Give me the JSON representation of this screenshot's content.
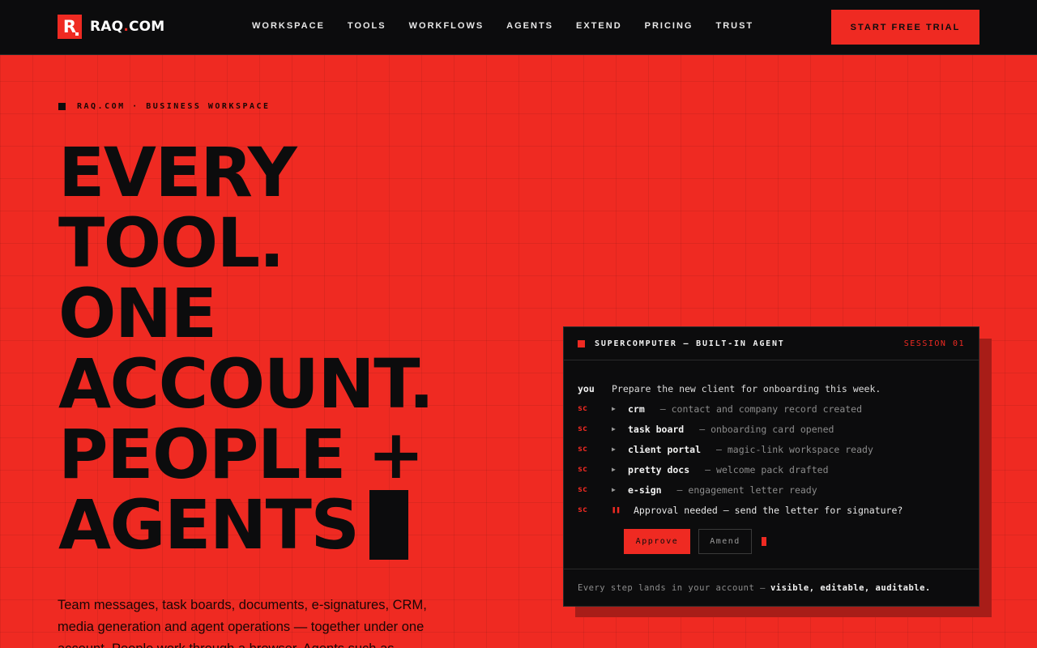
{
  "nav": {
    "logo_mark": "R",
    "logo_name": "RAQ",
    "logo_dot": ".",
    "logo_tld": "COM",
    "links": [
      "WORKSPACE",
      "TOOLS",
      "WORKFLOWS",
      "AGENTS",
      "EXTEND",
      "PRICING",
      "TRUST"
    ],
    "cta_label": "START FREE TRIAL"
  },
  "hero": {
    "eyebrow": "RAQ.COM · BUSINESS WORKSPACE",
    "headline_lines": [
      "EVERY",
      "TOOL.",
      "ONE",
      "ACCOUNT.",
      "PEOPLE +",
      "AGENTS"
    ],
    "subcopy": "Team messages, task boards, documents, e-signatures, CRM, media generation and agent operations — together under one account. People work through a browser. Agents such as"
  },
  "panel": {
    "title": "SUPERCOMPUTER — BUILT-IN AGENT",
    "session": "SESSION 01",
    "user_label": "you",
    "user_message": "Prepare the new client for onboarding this week.",
    "agent_label": "sc",
    "steps": [
      {
        "tool": "crm",
        "status": "— contact and company record created"
      },
      {
        "tool": "task board",
        "status": "— onboarding card opened"
      },
      {
        "tool": "client portal",
        "status": "— magic-link workspace ready"
      },
      {
        "tool": "pretty docs",
        "status": "— welcome pack drafted"
      },
      {
        "tool": "e-sign",
        "status": "— engagement letter ready"
      }
    ],
    "question": "Approval needed — send the letter for signature?",
    "approve_label": "Approve",
    "amend_label": "Amend",
    "footer_muted": "Every step lands in your account —",
    "footer_strong": "visible, editable, auditable."
  },
  "colors": {
    "brand_red": "#ef2a22",
    "ink": "#0c0c0d"
  }
}
